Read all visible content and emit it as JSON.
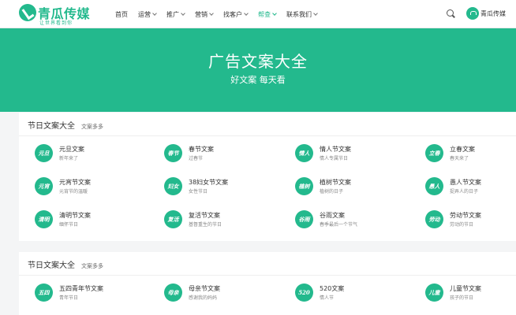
{
  "header": {
    "logo_text": "青瓜传媒",
    "logo_slogan": "让世界看到你",
    "nav": [
      {
        "label": "首页",
        "caret": false,
        "active": false
      },
      {
        "label": "运营",
        "caret": true,
        "active": false
      },
      {
        "label": "推广",
        "caret": true,
        "active": false
      },
      {
        "label": "营销",
        "caret": true,
        "active": false
      },
      {
        "label": "找客户",
        "caret": true,
        "active": false
      },
      {
        "label": "帮查",
        "caret": true,
        "active": true
      },
      {
        "label": "联系我们",
        "caret": true,
        "active": false
      }
    ],
    "user_name": "青瓜传媒"
  },
  "banner": {
    "title": "广告文案大全",
    "subtitle": "好文案 每天看"
  },
  "sections": [
    {
      "title": "节日文案大全",
      "more": "文案多多",
      "cards": [
        {
          "icon_text": "元旦",
          "title": "元旦文案",
          "sub": "新年来了"
        },
        {
          "icon_text": "春节",
          "title": "春节文案",
          "sub": "过春节"
        },
        {
          "icon_text": "情人",
          "title": "情人节文案",
          "sub": "情人专属节日"
        },
        {
          "icon_text": "立春",
          "title": "立春文案",
          "sub": "春天来了"
        },
        {
          "icon_text": "元宵",
          "title": "元宵节文案",
          "sub": "元宵节的温暖"
        },
        {
          "icon_text": "妇女",
          "title": "38妇女节文案",
          "sub": "女性节日"
        },
        {
          "icon_text": "植树",
          "title": "植树节文案",
          "sub": "植树的日子"
        },
        {
          "icon_text": "愚人",
          "title": "愚人节文案",
          "sub": "捉弄人的日子"
        },
        {
          "icon_text": "清明",
          "title": "清明节文案",
          "sub": "缅怀节日"
        },
        {
          "icon_text": "复活",
          "title": "复活节文案",
          "sub": "基督重生的节日"
        },
        {
          "icon_text": "谷雨",
          "title": "谷雨文案",
          "sub": "春季最后一个节气"
        },
        {
          "icon_text": "劳动",
          "title": "劳动节文案",
          "sub": "劳动的节日"
        }
      ]
    },
    {
      "title": "节日文案大全",
      "more": "文案多多",
      "cards": [
        {
          "icon_text": "五四",
          "title": "五四青年节文案",
          "sub": "青年节日"
        },
        {
          "icon_text": "母亲",
          "title": "母亲节文案",
          "sub": "感谢我的妈妈"
        },
        {
          "icon_text": "520",
          "title": "520文案",
          "sub": "情人节"
        },
        {
          "icon_text": "儿童",
          "title": "儿童节文案",
          "sub": "孩子的节日"
        }
      ]
    }
  ],
  "colors": {
    "accent": "#23b98d"
  }
}
